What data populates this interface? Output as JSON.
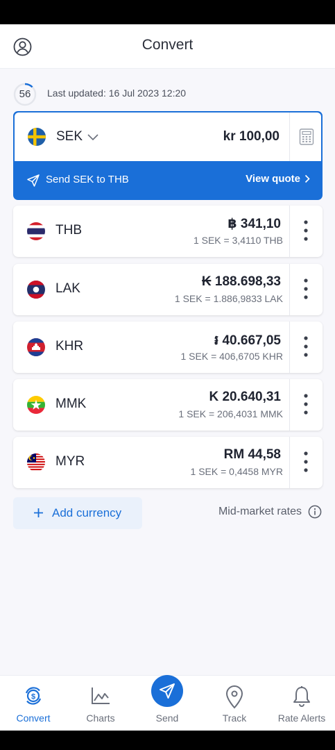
{
  "header": {
    "title": "Convert",
    "profile_icon": "profile-icon"
  },
  "refresh": {
    "countdown": "56",
    "last_updated": "Last updated: 16 Jul 2023 12:20"
  },
  "base": {
    "code": "SEK",
    "amount": "kr 100,00",
    "flag": "sweden-flag",
    "send_label": "Send SEK to THB",
    "view_quote": "View quote"
  },
  "currencies": [
    {
      "code": "THB",
      "amount": "฿ 341,10",
      "rate": "1 SEK = 3,4110 THB",
      "flag": "thailand-flag"
    },
    {
      "code": "LAK",
      "amount": "₭ 188.698,33",
      "rate": "1 SEK = 1.886,9833 LAK",
      "flag": "laos-flag"
    },
    {
      "code": "KHR",
      "amount": "៛ 40.667,05",
      "rate": "1 SEK = 406,6705 KHR",
      "flag": "cambodia-flag"
    },
    {
      "code": "MMK",
      "amount": "K 20.640,31",
      "rate": "1 SEK = 206,4031 MMK",
      "flag": "myanmar-flag"
    },
    {
      "code": "MYR",
      "amount": "RM 44,58",
      "rate": "1 SEK = 0,4458 MYR",
      "flag": "malaysia-flag"
    }
  ],
  "add_currency": "Add currency",
  "mid_market": "Mid-market rates",
  "tabs": [
    {
      "label": "Convert",
      "icon": "convert-icon",
      "active": true
    },
    {
      "label": "Charts",
      "icon": "chart-icon"
    },
    {
      "label": "Send",
      "icon": "send-icon"
    },
    {
      "label": "Track",
      "icon": "location-pin-icon"
    },
    {
      "label": "Rate Alerts",
      "icon": "bell-icon"
    }
  ],
  "colors": {
    "accent": "#1a6fd8",
    "background": "#f7f7fb",
    "card": "#ffffff"
  }
}
